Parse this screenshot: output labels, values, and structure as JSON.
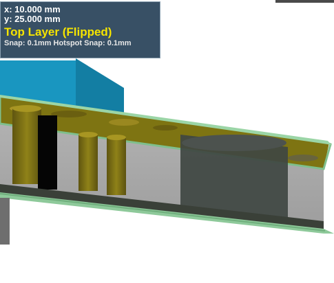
{
  "hud": {
    "x_readout": "x: 10.000 mm",
    "y_readout": "y: 25.000 mm",
    "layer": "Top Layer (Flipped)",
    "snap": "Snap: 0.1mm Hotspot Snap: 0.1mm"
  },
  "colors": {
    "layer_text": "#f5e400",
    "hud_background": "#1c3850",
    "component_blue": "#1d7fa6",
    "board_green": "#8ec99a",
    "copper": "#8a7a10",
    "void_gray": "#a9a9a9"
  }
}
